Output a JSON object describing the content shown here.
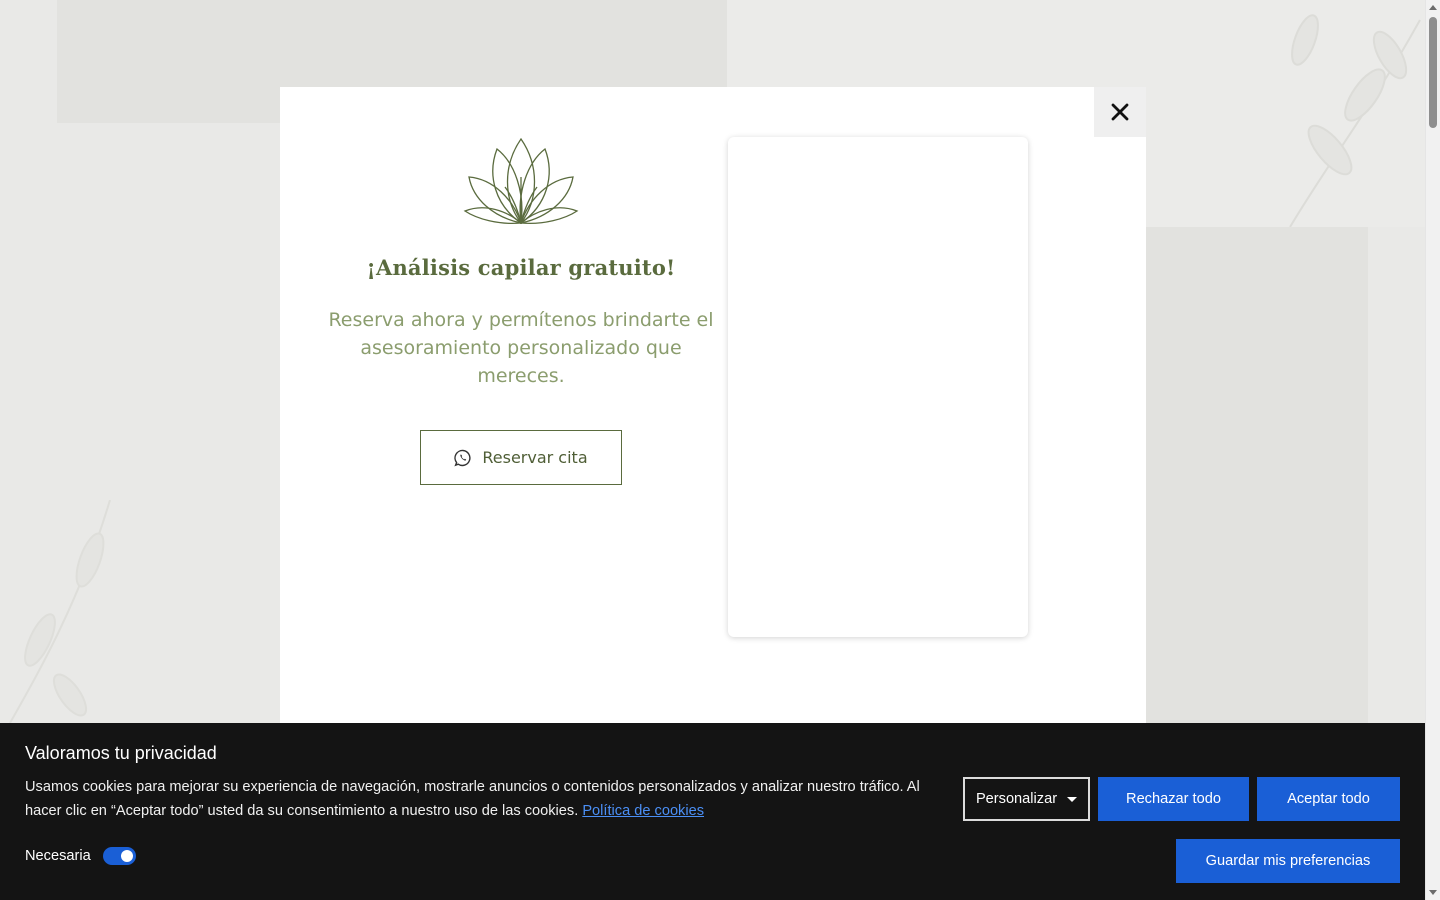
{
  "modal": {
    "title": "¡Análisis capilar gratuito!",
    "description": "Reserva ahora y permítenos brindarte el asesoramiento personalizado que mereces.",
    "reserve_button": "Reservar cita",
    "logo_icon": "lotus-icon",
    "reserve_icon": "whatsapp-icon",
    "close_icon": "close-icon",
    "colors": {
      "title": "#5a6b3e",
      "text": "#8b9d6e"
    }
  },
  "cookie_banner": {
    "title": "Valoramos tu privacidad",
    "description": "Usamos cookies para mejorar su experiencia de navegación, mostrarle anuncios o contenidos personalizados y analizar nuestro tráfico. Al hacer clic en “Aceptar todo” usted da su consentimiento a nuestro uso de las cookies.",
    "policy_link": "Política de cookies",
    "necessary_label": "Necesaria",
    "necessary_enabled": true,
    "customize_button": "Personalizar",
    "reject_button": "Rechazar todo",
    "accept_button": "Aceptar todo",
    "save_button": "Guardar mis preferencias",
    "colors": {
      "background": "#141414",
      "accent": "#1a5fd6"
    }
  }
}
